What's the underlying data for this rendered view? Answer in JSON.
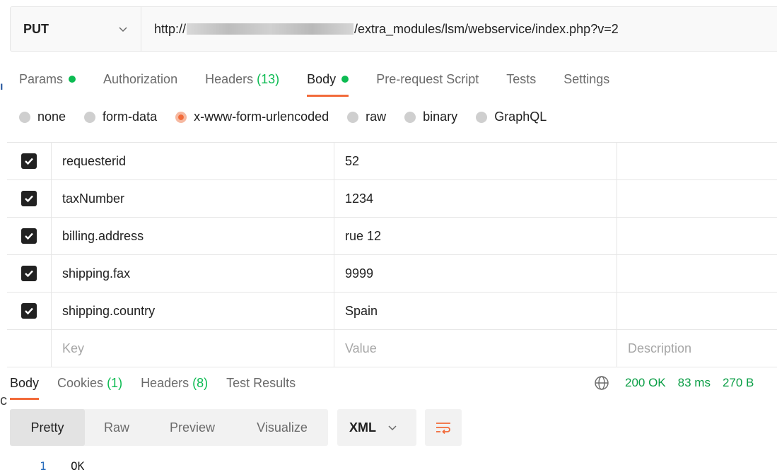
{
  "request": {
    "method": "PUT",
    "url_prefix": "http://",
    "url_suffix": "/extra_modules/lsm/webservice/index.php?v=2"
  },
  "side_marks": {
    "top": "ı",
    "bottom": "c"
  },
  "request_tabs": [
    {
      "label": "Params",
      "dot": true
    },
    {
      "label": "Authorization"
    },
    {
      "label": "Headers",
      "count": "(13)"
    },
    {
      "label": "Body",
      "dot": true,
      "active": true
    },
    {
      "label": "Pre-request Script"
    },
    {
      "label": "Tests"
    },
    {
      "label": "Settings"
    }
  ],
  "body_types": [
    "none",
    "form-data",
    "x-www-form-urlencoded",
    "raw",
    "binary",
    "GraphQL"
  ],
  "body_type_selected": "x-www-form-urlencoded",
  "params": [
    {
      "key": "requesterid",
      "value": "52",
      "checked": true
    },
    {
      "key": "taxNumber",
      "value": "1234",
      "checked": true
    },
    {
      "key": "billing.address",
      "value": "rue 12",
      "checked": true
    },
    {
      "key": "shipping.fax",
      "value": "9999",
      "checked": true
    },
    {
      "key": "shipping.country",
      "value": "Spain",
      "checked": true
    }
  ],
  "params_placeholder": {
    "key": "Key",
    "value": "Value",
    "description": "Description"
  },
  "response_tabs": [
    {
      "label": "Body",
      "active": true
    },
    {
      "label": "Cookies",
      "count": "(1)"
    },
    {
      "label": "Headers",
      "count": "(8)"
    },
    {
      "label": "Test Results"
    }
  ],
  "response_status": {
    "code": "200 OK",
    "time": "83 ms",
    "size": "270 B"
  },
  "view_modes": [
    "Pretty",
    "Raw",
    "Preview",
    "Visualize"
  ],
  "view_mode_selected": "Pretty",
  "format": "XML",
  "response_body": [
    {
      "line": "1",
      "text": "OK"
    }
  ],
  "colors": {
    "accent": "#f26b3a",
    "success": "#0cbb52"
  }
}
